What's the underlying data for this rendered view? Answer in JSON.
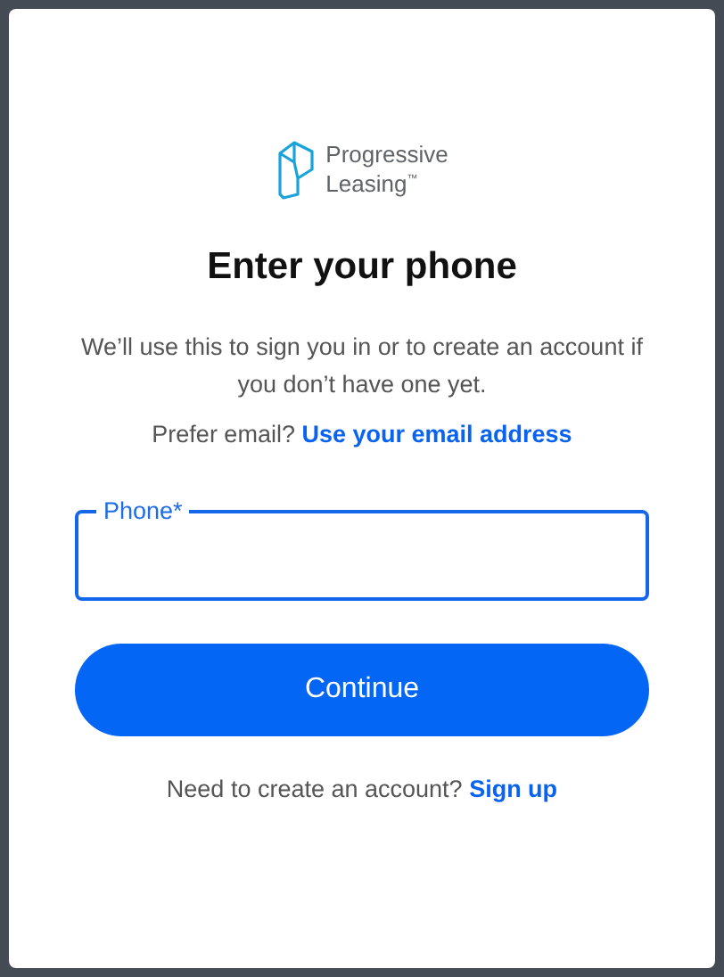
{
  "logo": {
    "lines": [
      "Progressive",
      "Leasing$^{™}$"
    ]
  },
  "heading": "Enter your phone",
  "intro": "We’ll use this to sign you in or to create an account if you don’t have one yet.",
  "alt_option": {
    "text": "Prefer email?",
    "link": "Use your email address"
  },
  "phone_field": {
    "label": "Phone*",
    "focused": true
  },
  "continue_button": "Continue",
  "footer": {
    "text": "Need to create an account?",
    "link": "Sign up"
  }
}
